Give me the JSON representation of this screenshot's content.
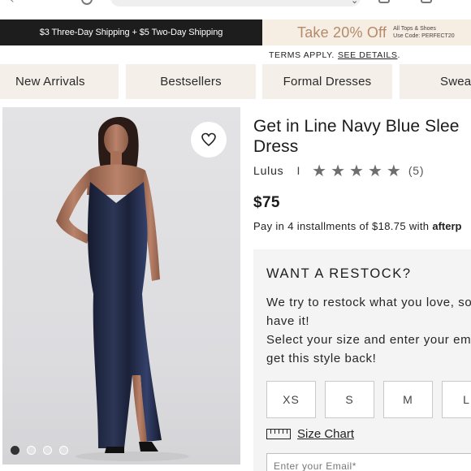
{
  "promo": {
    "shipping_text": "$3 Three-Day Shipping + $5 Two-Day Shipping",
    "discount_headline": "Take 20% Off",
    "discount_line1": "All Tops & Shoes",
    "discount_line2": "Use Code: PERFECT20",
    "terms_text": "TERMS APPLY.",
    "terms_link": "SEE DETAILS",
    "terms_end": "."
  },
  "nav": {
    "items": [
      "New Arrivals",
      "Bestsellers",
      "Formal Dresses",
      "Swea"
    ]
  },
  "product": {
    "title_line1": "Get in Line Navy Blue Slee",
    "title_line2": "Dress",
    "brand": "Lulus",
    "separator": "I",
    "stars": "★★★★★",
    "rating": 5,
    "review_count": "(5)",
    "price": "$75",
    "installments_text": "Pay in 4 installments of $18.75 with",
    "installments_provider": "afterp",
    "image_dots": {
      "count": 4,
      "active_index": 0
    }
  },
  "restock": {
    "heading": "WANT A RESTOCK?",
    "message_lines": [
      "We try to restock what you love, so",
      "have it!",
      "Select your size and enter your em",
      "get this style back!"
    ],
    "sizes": [
      "XS",
      "S",
      "M",
      "L"
    ],
    "size_chart_label": "Size Chart",
    "email_placeholder": "Enter your Email*"
  },
  "colors": {
    "promo_dark": "#1d1d1d",
    "promo_light": "#f7eee3",
    "promo_accent": "#b48a6b",
    "nav_bg": "#f5efe9",
    "panel_bg": "#f4f4f4",
    "dress_navy": "#1e2640"
  },
  "icons": {
    "favorite": "heart-outline-icon",
    "size_chart": "ruler-icon",
    "rating": "star-icon"
  }
}
